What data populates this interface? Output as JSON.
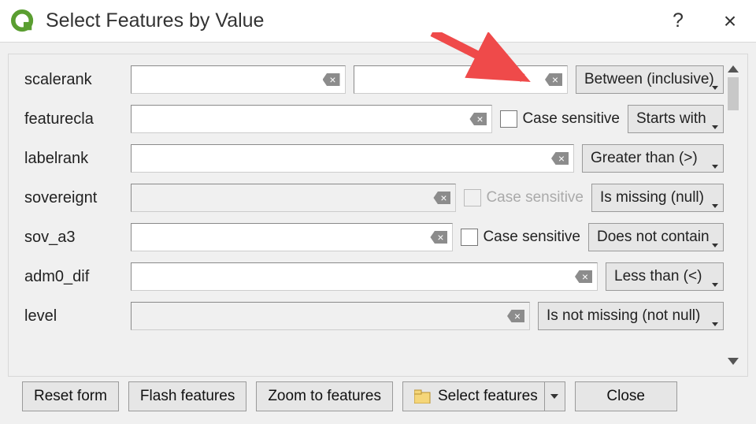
{
  "title": "Select Features by Value",
  "fields": {
    "scalerank": {
      "label": "scalerank",
      "op": "Between (inclusive)"
    },
    "featurecla": {
      "label": "featurecla",
      "op": "Starts with",
      "chk": "Case sensitive"
    },
    "labelrank": {
      "label": "labelrank",
      "op": "Greater than (>)"
    },
    "sovereignt": {
      "label": "sovereignt",
      "op": "Is missing (null)",
      "chk": "Case sensitive"
    },
    "sov_a3": {
      "label": "sov_a3",
      "op": "Does not contain",
      "chk": "Case sensitive"
    },
    "adm0_dif": {
      "label": "adm0_dif",
      "op": "Less than (<)"
    },
    "level": {
      "label": "level",
      "op": "Is not missing (not null)"
    }
  },
  "footer": {
    "reset": "Reset form",
    "flash": "Flash features",
    "zoom": "Zoom to features",
    "select": "Select features",
    "close": "Close"
  }
}
